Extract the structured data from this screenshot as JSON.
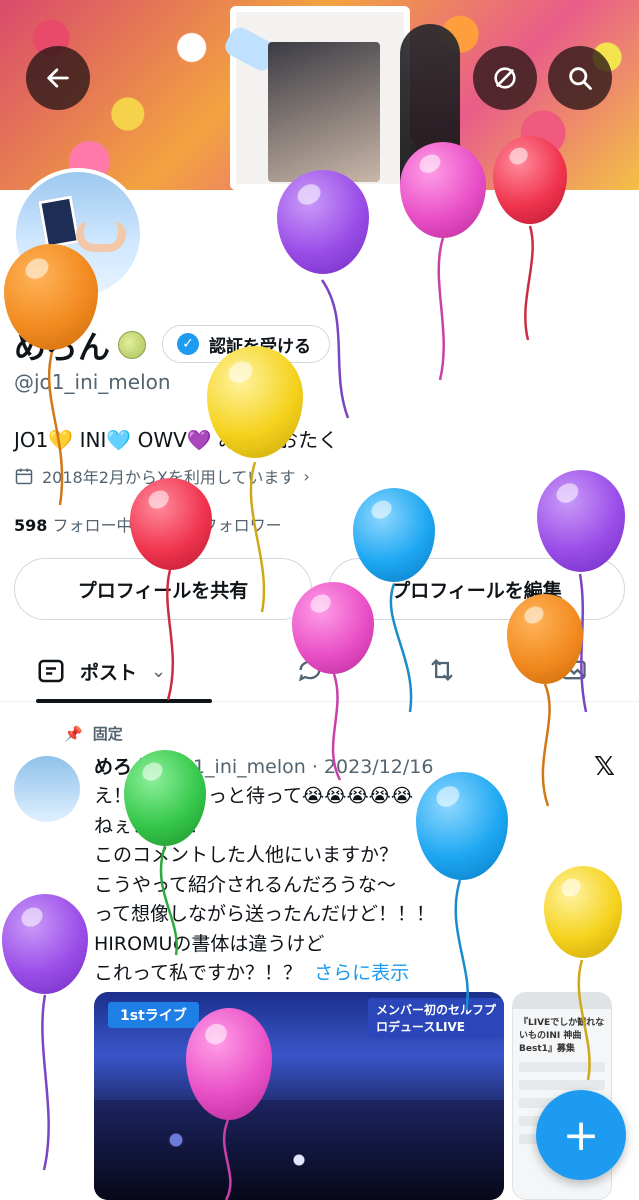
{
  "profile": {
    "display_name": "めろん",
    "handle": "@jo1_ini_melon",
    "verify_label": "認証を受ける",
    "bio": "JO1💛 INI🩵 OWV💜 みんなおたく",
    "joined": "2018年2月からXを利用しています",
    "following_count": "598",
    "following_label": "フォロー中",
    "followers_label": "フォロワー",
    "share_button": "プロフィールを共有",
    "edit_button": "プロフィールを編集"
  },
  "tabs": {
    "posts_label": "ポスト"
  },
  "pinned_post": {
    "pinned_label": "固定",
    "author": "めろん",
    "handle": "@jo1_ini_melon",
    "date": "2023/12/16",
    "text": "え！？？ちょっと待って😭😭😭😭😭\nねぇ！！！！\nこのコメントした人他にいますか？\nこうやって紹介されるんだろうな〜\nって想像しながら送ったんだけど！！！\nHIROMUの書体は違うけど\nこれって私ですか？！？",
    "more_label": "さらに表示",
    "media_tag_1": "1stライブ",
    "media_tag_2": "メンバー初のセルフプロデュースLIVE",
    "side_header": "『LIVEでしか観れないものINI 神曲Best1』募集"
  },
  "balloon_colors": [
    "#f28a1f",
    "#9b4de8",
    "#e94fc7",
    "#f0344f",
    "#f5d21d",
    "#1da7f2",
    "#35c74a"
  ]
}
